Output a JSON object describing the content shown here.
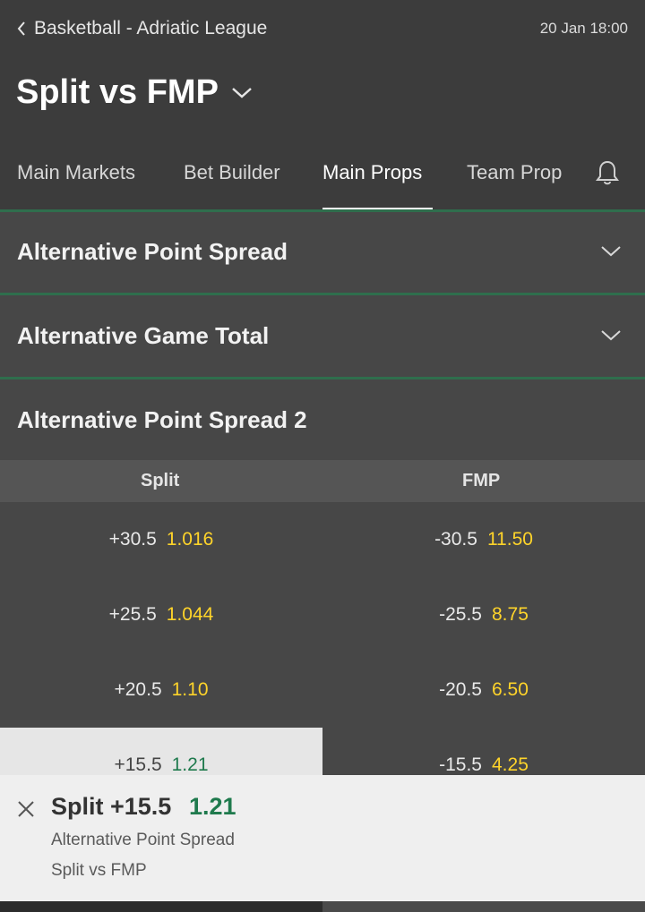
{
  "header": {
    "back_label": "Basketball - Adriatic League",
    "datetime": "20 Jan 18:00",
    "event_title": "Split vs FMP"
  },
  "tabs": [
    {
      "label": "Main Markets",
      "active": false
    },
    {
      "label": "Bet Builder",
      "active": false
    },
    {
      "label": "Main Props",
      "active": true
    },
    {
      "label": "Team Prop",
      "active": false
    }
  ],
  "markets": [
    {
      "title": "Alternative Point Spread",
      "collapsed": true
    },
    {
      "title": "Alternative Game Total",
      "collapsed": true
    },
    {
      "title": "Alternative Point Spread 2",
      "collapsed": false
    }
  ],
  "spread_table": {
    "columns": [
      "Split",
      "FMP"
    ],
    "rows": [
      {
        "home_line": "+30.5",
        "home_price": "1.016",
        "away_line": "-30.5",
        "away_price": "11.50"
      },
      {
        "home_line": "+25.5",
        "home_price": "1.044",
        "away_line": "-25.5",
        "away_price": "8.75"
      },
      {
        "home_line": "+20.5",
        "home_price": "1.10",
        "away_line": "-20.5",
        "away_price": "6.50"
      },
      {
        "home_line": "+15.5",
        "home_price": "1.21",
        "away_line": "-15.5",
        "away_price": "4.25"
      }
    ]
  },
  "betslip": {
    "selection": "Split +15.5",
    "price": "1.21",
    "market": "Alternative Point Spread",
    "event": "Split vs FMP"
  },
  "colors": {
    "background": "#3c3c3c",
    "price": "#ffd42a",
    "accent_green": "#1f7a4d"
  }
}
